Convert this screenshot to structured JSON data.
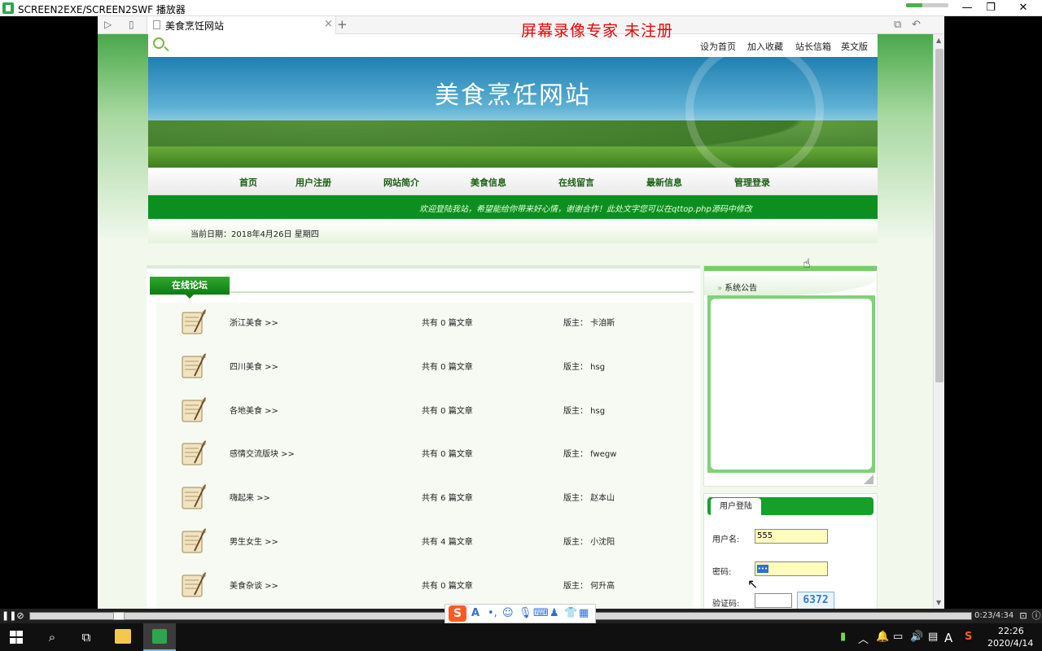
{
  "player_window": {
    "title": "SCREEN2EXE/SCREEN2SWF 播放器",
    "watermark": "屏幕录像专家  未注册",
    "time_display": "0:23/4:34",
    "progress_fraction": 0.084
  },
  "browser": {
    "tab_title": "美食烹饪网站",
    "new_tab_label": "+"
  },
  "site": {
    "top_links": [
      "设为首页",
      "加入收藏",
      "站长信箱",
      "英文版"
    ],
    "title": "美食烹饪网站",
    "nav": [
      "首页",
      "用户注册",
      "网站简介",
      "美食信息",
      "在线留言",
      "最新信息",
      "管理登录"
    ],
    "ticker": "欢迎登陆我站，希望能给你带来好心情，谢谢合作！此处文字您可以在qttop.php源码中修改",
    "date": "当前日期：2018年4月26日 星期四"
  },
  "forum": {
    "tab_label": "在线论坛",
    "boards": [
      {
        "name": "浙江美食 >>",
        "count": "共有 0 篇文章",
        "moderator": "版主： 卡洎斯"
      },
      {
        "name": "四川美食 >>",
        "count": "共有 0 篇文章",
        "moderator": "版主： hsg"
      },
      {
        "name": "各地美食 >>",
        "count": "共有 0 篇文章",
        "moderator": "版主： hsg"
      },
      {
        "name": "感情交流版块 >>",
        "count": "共有 0 篇文章",
        "moderator": "版主： fwegw"
      },
      {
        "name": "嗨起来 >>",
        "count": "共有 6 篇文章",
        "moderator": "版主： 赵本山"
      },
      {
        "name": "男生女生 >>",
        "count": "共有 4 篇文章",
        "moderator": "版主： 小沈阳"
      },
      {
        "name": "美食杂谈 >>",
        "count": "共有 0 篇文章",
        "moderator": "版主： 何升高"
      }
    ]
  },
  "notice": {
    "title": "系统公告"
  },
  "login": {
    "tab_label": "用户登陆",
    "username_label": "用户名:",
    "username_value": "555",
    "password_label": "密码:",
    "password_value": "•••",
    "captcha_label": "验证码:",
    "captcha_code": "6372"
  },
  "taskbar": {
    "time": "22:26",
    "date": "2020/4/14",
    "ime_letter": "A"
  },
  "icons": {
    "player_app": "screen2exe-icon",
    "board": "scroll-quill-icon"
  },
  "colors": {
    "site_green": "#0d8f1f",
    "watermark_red": "#ee0000",
    "field_yellow": "#fffdbb"
  }
}
